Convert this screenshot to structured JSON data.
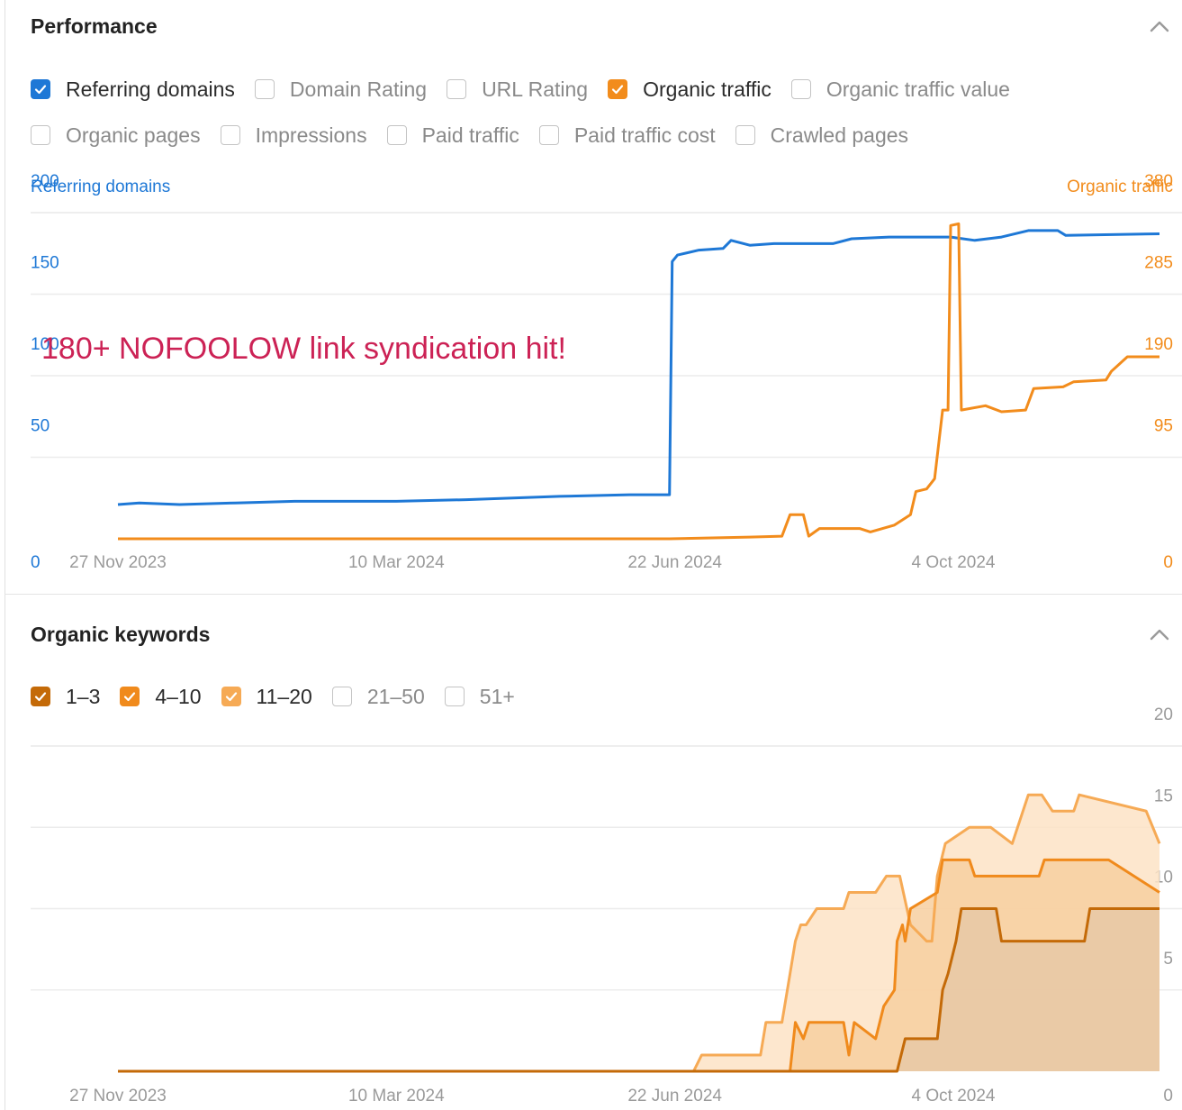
{
  "performance": {
    "title": "Performance",
    "checkboxes_row1": [
      {
        "label": "Referring domains",
        "checked": true,
        "color": "#1e78d6"
      },
      {
        "label": "Domain Rating",
        "checked": false
      },
      {
        "label": "URL Rating",
        "checked": false
      },
      {
        "label": "Organic traffic",
        "checked": true,
        "color": "#f28c1c"
      },
      {
        "label": "Organic traffic value",
        "checked": false
      }
    ],
    "checkboxes_row2": [
      {
        "label": "Organic pages",
        "checked": false
      },
      {
        "label": "Impressions",
        "checked": false
      },
      {
        "label": "Paid traffic",
        "checked": false
      },
      {
        "label": "Paid traffic cost",
        "checked": false
      },
      {
        "label": "Crawled pages",
        "checked": false
      }
    ],
    "annotation": "180+ NOFOOLOW link syndication hit!"
  },
  "keywords": {
    "title": "Organic keywords",
    "checkboxes": [
      {
        "label": "1–3",
        "checked": true,
        "color": "#c46a08"
      },
      {
        "label": "4–10",
        "checked": true,
        "color": "#f08a1c"
      },
      {
        "label": "11–20",
        "checked": true,
        "color": "#f6aa55"
      },
      {
        "label": "21–50",
        "checked": false
      },
      {
        "label": "51+",
        "checked": false
      }
    ]
  },
  "chart_data": [
    {
      "type": "line",
      "x_ticks": [
        "27 Nov 2023",
        "10 Mar 2024",
        "22 Jun 2024",
        "4 Oct 2024"
      ],
      "y_left_label": "Referring domains",
      "y_right_label": "Organic traffic",
      "y_left_ticks": [
        "0",
        "50",
        "100",
        "150",
        "200"
      ],
      "y_right_ticks": [
        "0",
        "95",
        "190",
        "285",
        "380"
      ],
      "ylim_left": [
        0,
        200
      ],
      "ylim_right": [
        0,
        380
      ],
      "x_domain": [
        "2023-11-27",
        "2024-12-20"
      ],
      "grid": true,
      "series": [
        {
          "name": "Referring domains",
          "axis": "left",
          "color": "#1e78d6",
          "points": [
            [
              "2023-11-27",
              21
            ],
            [
              "2023-12-05",
              22
            ],
            [
              "2023-12-20",
              21
            ],
            [
              "2024-01-10",
              22
            ],
            [
              "2024-02-01",
              23
            ],
            [
              "2024-03-10",
              23
            ],
            [
              "2024-04-05",
              24
            ],
            [
              "2024-05-10",
              26
            ],
            [
              "2024-06-05",
              27
            ],
            [
              "2024-06-20",
              27
            ],
            [
              "2024-06-21",
              170
            ],
            [
              "2024-06-23",
              174
            ],
            [
              "2024-07-01",
              177
            ],
            [
              "2024-07-10",
              178
            ],
            [
              "2024-07-13",
              183
            ],
            [
              "2024-07-20",
              180
            ],
            [
              "2024-07-29",
              181
            ],
            [
              "2024-08-20",
              181
            ],
            [
              "2024-08-27",
              184
            ],
            [
              "2024-09-10",
              185
            ],
            [
              "2024-10-03",
              185
            ],
            [
              "2024-10-12",
              183
            ],
            [
              "2024-10-22",
              185
            ],
            [
              "2024-11-01",
              189
            ],
            [
              "2024-11-12",
              189
            ],
            [
              "2024-11-15",
              186
            ],
            [
              "2024-12-20",
              187
            ]
          ]
        },
        {
          "name": "Organic traffic",
          "axis": "right",
          "color": "#f28c1c",
          "points": [
            [
              "2023-11-27",
              0
            ],
            [
              "2024-06-20",
              0
            ],
            [
              "2024-07-20",
              2
            ],
            [
              "2024-08-01",
              3
            ],
            [
              "2024-08-04",
              28
            ],
            [
              "2024-08-09",
              28
            ],
            [
              "2024-08-11",
              3
            ],
            [
              "2024-08-15",
              12
            ],
            [
              "2024-08-30",
              12
            ],
            [
              "2024-09-03",
              8
            ],
            [
              "2024-09-12",
              16
            ],
            [
              "2024-09-18",
              28
            ],
            [
              "2024-09-20",
              55
            ],
            [
              "2024-09-24",
              58
            ],
            [
              "2024-09-27",
              70
            ],
            [
              "2024-09-30",
              150
            ],
            [
              "2024-10-02",
              150
            ],
            [
              "2024-10-03",
              365
            ],
            [
              "2024-10-06",
              367
            ],
            [
              "2024-10-07",
              150
            ],
            [
              "2024-10-16",
              155
            ],
            [
              "2024-10-22",
              148
            ],
            [
              "2024-10-31",
              150
            ],
            [
              "2024-11-03",
              175
            ],
            [
              "2024-11-14",
              177
            ],
            [
              "2024-11-18",
              183
            ],
            [
              "2024-11-30",
              185
            ],
            [
              "2024-12-02",
              195
            ],
            [
              "2024-12-08",
              212
            ],
            [
              "2024-12-20",
              212
            ]
          ]
        }
      ]
    },
    {
      "type": "area",
      "stacked": true,
      "x_ticks": [
        "27 Nov 2023",
        "10 Mar 2024",
        "22 Jun 2024",
        "4 Oct 2024"
      ],
      "y_right_ticks": [
        "0",
        "5",
        "10",
        "15",
        "20"
      ],
      "ylim": [
        0,
        20
      ],
      "x_domain": [
        "2023-11-27",
        "2024-12-20"
      ],
      "grid": true,
      "series": [
        {
          "name": "1–3",
          "color": "#c46a08",
          "points": [
            [
              "2023-11-27",
              0
            ],
            [
              "2024-09-13",
              0
            ],
            [
              "2024-09-16",
              2
            ],
            [
              "2024-09-28",
              2
            ],
            [
              "2024-09-30",
              5
            ],
            [
              "2024-10-02",
              6
            ],
            [
              "2024-10-05",
              8
            ],
            [
              "2024-10-07",
              10
            ],
            [
              "2024-10-20",
              10
            ],
            [
              "2024-10-22",
              8
            ],
            [
              "2024-11-22",
              8
            ],
            [
              "2024-11-24",
              10
            ],
            [
              "2024-12-20",
              10
            ]
          ]
        },
        {
          "name": "4–10",
          "color": "#f08a1c",
          "points": [
            [
              "2023-11-27",
              0
            ],
            [
              "2024-08-04",
              0
            ],
            [
              "2024-08-06",
              3
            ],
            [
              "2024-08-09",
              2
            ],
            [
              "2024-08-11",
              3
            ],
            [
              "2024-08-24",
              3
            ],
            [
              "2024-08-26",
              1
            ],
            [
              "2024-08-28",
              3
            ],
            [
              "2024-09-05",
              2
            ],
            [
              "2024-09-08",
              4
            ],
            [
              "2024-09-12",
              5
            ],
            [
              "2024-09-13",
              8
            ],
            [
              "2024-09-15",
              9
            ],
            [
              "2024-09-16",
              8
            ],
            [
              "2024-09-18",
              10
            ],
            [
              "2024-09-28",
              11
            ],
            [
              "2024-09-30",
              13
            ],
            [
              "2024-10-10",
              13
            ],
            [
              "2024-10-12",
              12
            ],
            [
              "2024-11-05",
              12
            ],
            [
              "2024-11-07",
              13
            ],
            [
              "2024-12-01",
              13
            ],
            [
              "2024-12-20",
              11
            ]
          ]
        },
        {
          "name": "11–20",
          "color": "#f6aa55",
          "points": [
            [
              "2023-11-27",
              0
            ],
            [
              "2024-06-29",
              0
            ],
            [
              "2024-07-02",
              1
            ],
            [
              "2024-07-24",
              1
            ],
            [
              "2024-07-26",
              3
            ],
            [
              "2024-08-01",
              3
            ],
            [
              "2024-08-03",
              5
            ],
            [
              "2024-08-04",
              6
            ],
            [
              "2024-08-06",
              8
            ],
            [
              "2024-08-08",
              9
            ],
            [
              "2024-08-10",
              9
            ],
            [
              "2024-08-14",
              10
            ],
            [
              "2024-08-24",
              10
            ],
            [
              "2024-08-26",
              11
            ],
            [
              "2024-09-05",
              11
            ],
            [
              "2024-09-09",
              12
            ],
            [
              "2024-09-14",
              12
            ],
            [
              "2024-09-18",
              9
            ],
            [
              "2024-09-24",
              8
            ],
            [
              "2024-09-26",
              8
            ],
            [
              "2024-09-28",
              12
            ],
            [
              "2024-10-01",
              14
            ],
            [
              "2024-10-10",
              15
            ],
            [
              "2024-10-18",
              15
            ],
            [
              "2024-10-26",
              14
            ],
            [
              "2024-11-01",
              17
            ],
            [
              "2024-11-06",
              17
            ],
            [
              "2024-11-10",
              16
            ],
            [
              "2024-11-18",
              16
            ],
            [
              "2024-11-20",
              17
            ],
            [
              "2024-12-15",
              16
            ],
            [
              "2024-12-20",
              14
            ]
          ]
        }
      ]
    }
  ]
}
